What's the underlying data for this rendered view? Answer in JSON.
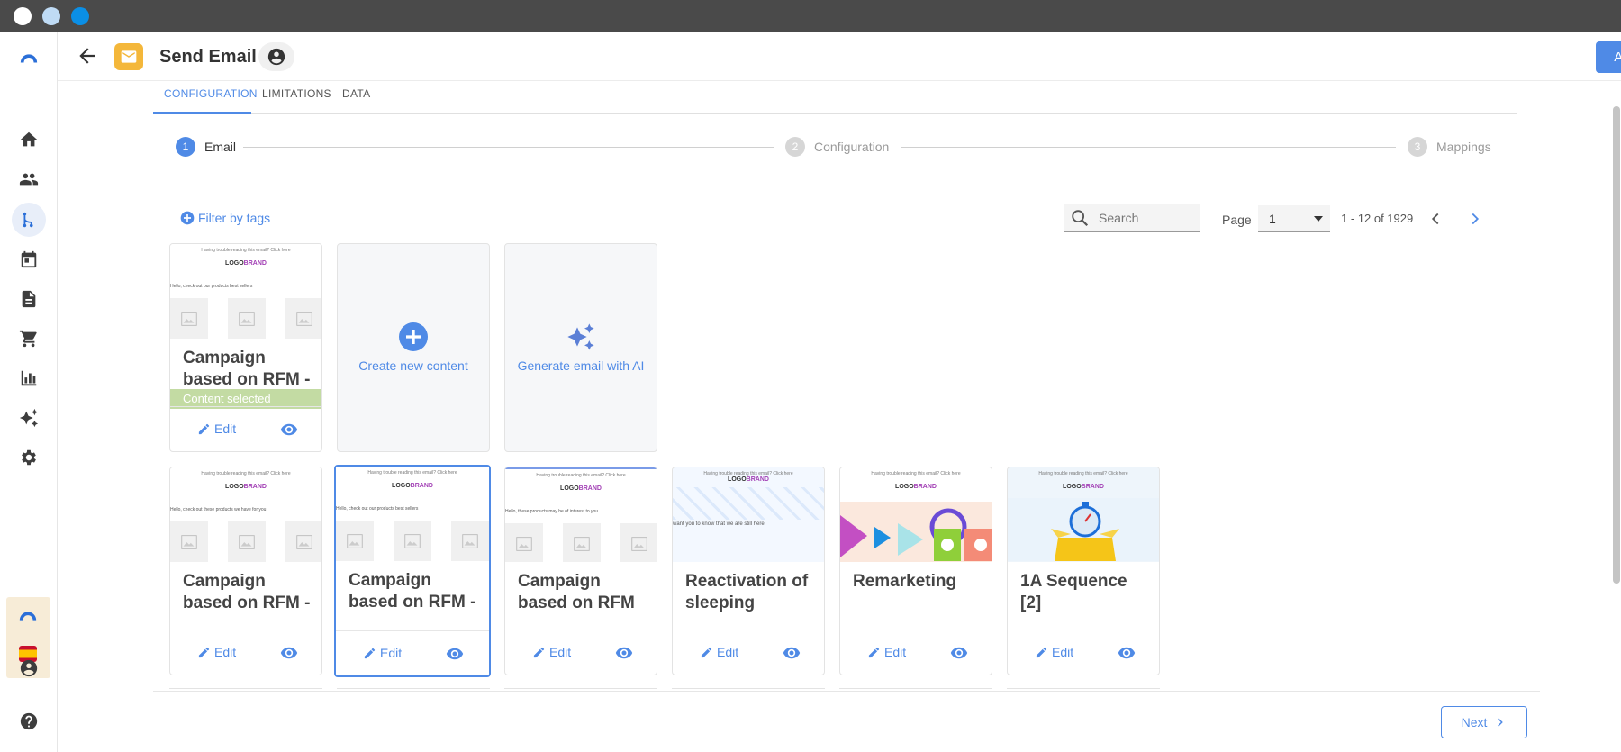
{
  "window": {
    "dots": [
      "#ffffff",
      "#bfdbf5",
      "#0b8fe6"
    ]
  },
  "sidebar": {
    "items": [
      {
        "name": "logo"
      },
      {
        "name": "home-icon"
      },
      {
        "name": "people-icon"
      },
      {
        "name": "workflow-icon"
      },
      {
        "name": "calendar-icon"
      },
      {
        "name": "document-icon"
      },
      {
        "name": "cart-icon"
      },
      {
        "name": "chart-icon"
      },
      {
        "name": "sparkle-icon"
      },
      {
        "name": "gear-icon"
      }
    ],
    "active": "workflow-icon"
  },
  "header": {
    "title": "Send Email",
    "apply_label": "Apply"
  },
  "tabs": [
    {
      "label": "CONFIGURATION",
      "active": true
    },
    {
      "label": "LIMITATIONS",
      "active": false
    },
    {
      "label": "DATA",
      "active": false
    }
  ],
  "stepper": [
    {
      "num": "1",
      "label": "Email",
      "active": true
    },
    {
      "num": "2",
      "label": "Configuration",
      "active": false
    },
    {
      "num": "3",
      "label": "Mappings",
      "active": false
    }
  ],
  "toolbar": {
    "filter_label": "Filter by tags",
    "search_placeholder": "Search",
    "page_label": "Page",
    "page_value": "1",
    "range_text": "1 - 12 of 1929"
  },
  "thumb_text": {
    "tiny": "Having trouble reading this email? Click here",
    "logo_a": "LOGO",
    "logo_b": "BRAND"
  },
  "cards": {
    "first": {
      "title": "Campaign based on RFM -",
      "selected_text": "Content selected",
      "edit": "Edit",
      "line": "Hello, check out our products best sellers"
    },
    "create": {
      "label": "Create new content"
    },
    "ai": {
      "label": "Generate email with AI"
    },
    "row2": [
      {
        "title": "Campaign based on RFM -",
        "edit": "Edit",
        "line": "Hello, check out these products we have for you"
      },
      {
        "title": "Campaign based on RFM -",
        "edit": "Edit",
        "line": "Hello, check out our products best sellers"
      },
      {
        "title": "Campaign based on RFM",
        "edit": "Edit",
        "line": "Hello, these products may be of interest to you"
      },
      {
        "title": "Reactivation of sleeping",
        "edit": "Edit",
        "line": "want you to know that we are still here!"
      },
      {
        "title": "Remarketing",
        "edit": "Edit",
        "line": ""
      },
      {
        "title": "1A Sequence [2]",
        "edit": "Edit",
        "line": ""
      }
    ]
  },
  "footer": {
    "next_label": "Next"
  }
}
